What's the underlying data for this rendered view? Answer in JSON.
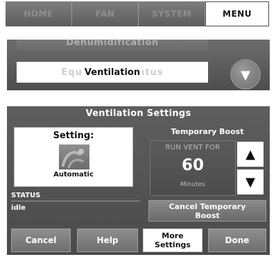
{
  "tabs": [
    {
      "label": "HOME",
      "active": false
    },
    {
      "label": "FAN",
      "active": false
    },
    {
      "label": "SYSTEM",
      "active": false
    },
    {
      "label": "MENU",
      "active": true
    }
  ],
  "menu_list": {
    "partial_item_above": "Dehumidification",
    "selected_item": "Ventilation",
    "selected_item_ghost": "Equipment Status",
    "scroll_icon": "chevron-down-icon"
  },
  "ventilation_settings": {
    "title": "Ventilation Settings",
    "setting": {
      "label": "Setting:",
      "value": "Automatic",
      "icon": "automatic-icon"
    },
    "status": {
      "label": "STATUS",
      "value": "idle"
    },
    "temporary_boost": {
      "title": "Temporary Boost",
      "caption": "RUN VENT FOR",
      "value": "60",
      "unit": "Minutes",
      "up_glyph": "▲",
      "down_glyph": "▼",
      "cancel_label_line1": "Cancel Temporary",
      "cancel_label_line2": "Boost"
    },
    "buttons": {
      "cancel": "Cancel",
      "help": "Help",
      "more_line1": "More",
      "more_line2": "Settings",
      "done": "Done"
    }
  },
  "colors": {
    "panel_dark": "#4e4e4e",
    "button_gray": "#7a7a7a",
    "highlight_white": "#ffffff"
  }
}
